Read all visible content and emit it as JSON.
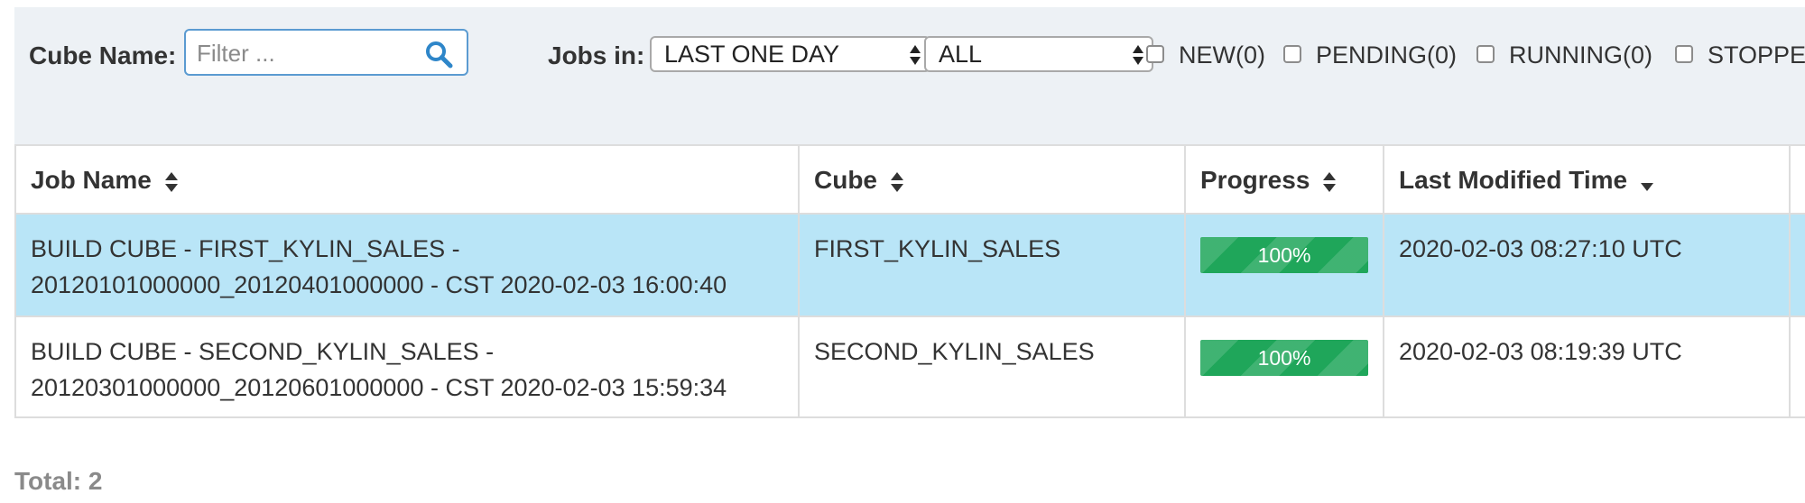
{
  "filters": {
    "cube_name_label": "Cube Name:",
    "cube_filter_placeholder": "Filter ...",
    "jobs_in_label": "Jobs in:",
    "time_range_selected": "LAST ONE DAY",
    "status_selected": "ALL",
    "checkboxes": [
      {
        "label": "NEW(0)",
        "checked": false
      },
      {
        "label": "PENDING(0)",
        "checked": false
      },
      {
        "label": "RUNNING(0)",
        "checked": false
      },
      {
        "label": "STOPPE",
        "checked": false
      }
    ]
  },
  "table": {
    "columns": [
      "Job Name",
      "Cube",
      "Progress",
      "Last Modified Time"
    ],
    "rows": [
      {
        "job_name_line1": "BUILD CUBE - FIRST_KYLIN_SALES -",
        "job_name_line2": "20120101000000_20120401000000 - CST 2020-02-03 16:00:40",
        "cube": "FIRST_KYLIN_SALES",
        "progress": "100%",
        "progress_fraction": 1.0,
        "last_modified": "2020-02-03 08:27:10 UTC",
        "selected": true
      },
      {
        "job_name_line1": "BUILD CUBE - SECOND_KYLIN_SALES -",
        "job_name_line2": "20120301000000_20120601000000 - CST 2020-02-03 15:59:34",
        "cube": "SECOND_KYLIN_SALES",
        "progress": "100%",
        "progress_fraction": 1.0,
        "last_modified": "2020-02-03 08:19:39 UTC",
        "selected": false
      }
    ]
  },
  "footer": {
    "total": "Total: 2"
  },
  "colors": {
    "filter_bar_bg": "#edf1f5",
    "selected_row_bg": "#b9e5f7",
    "progress_green": "#1fa65a",
    "search_border": "#5b9bd1"
  },
  "icons": {
    "search": "search-icon",
    "sort": "sort-both-icon",
    "sort_desc": "sort-desc-icon",
    "select_arrows": "select-arrows-icon"
  }
}
